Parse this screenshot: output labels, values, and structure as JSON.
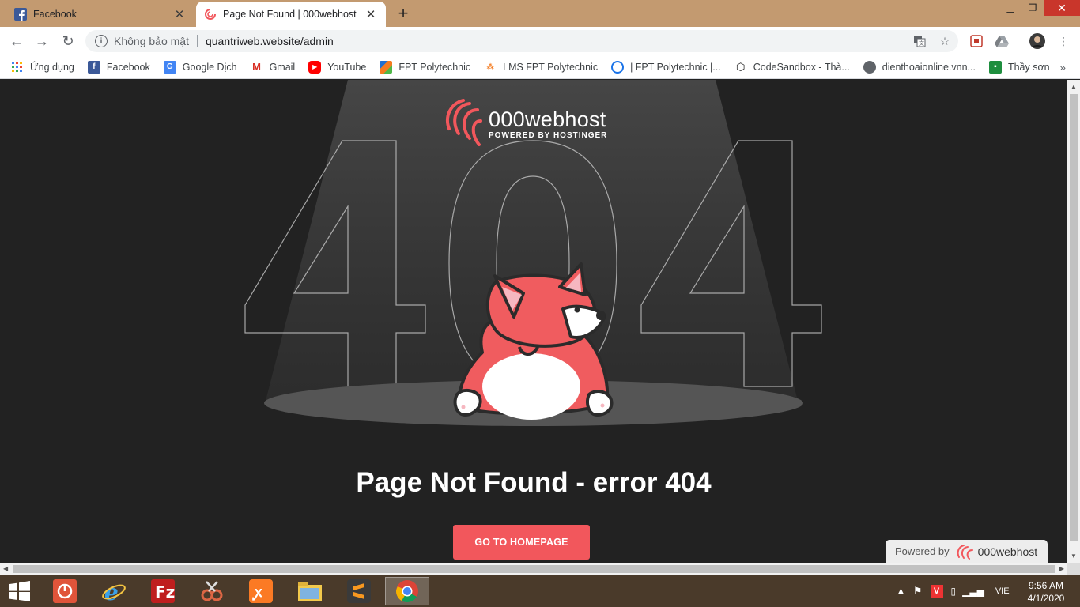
{
  "tabs": [
    {
      "title": "Facebook",
      "favicon": "facebook-icon"
    },
    {
      "title": "Page Not Found | 000webhost",
      "favicon": "000webhost-icon"
    }
  ],
  "address": {
    "security_label": "Không bảo mật",
    "url": "quantriweb.website/admin"
  },
  "bookmarks": [
    {
      "label": "Ứng dụng",
      "icon": "apps-grid-icon"
    },
    {
      "label": "Facebook",
      "icon": "facebook-icon"
    },
    {
      "label": "Google Dịch",
      "icon": "google-translate-icon"
    },
    {
      "label": "Gmail",
      "icon": "gmail-icon"
    },
    {
      "label": "YouTube",
      "icon": "youtube-icon"
    },
    {
      "label": "FPT Polytechnic",
      "icon": "fpt-icon"
    },
    {
      "label": "LMS FPT Polytechnic",
      "icon": "lms-icon"
    },
    {
      "label": "| FPT Polytechnic |...",
      "icon": "circle-icon"
    },
    {
      "label": "CodeSandbox - Thà...",
      "icon": "codesandbox-icon"
    },
    {
      "label": "dienthoaionline.vnn...",
      "icon": "globe-icon"
    },
    {
      "label": "Thầy sơn",
      "icon": "classroom-icon"
    }
  ],
  "page": {
    "logo_name": "000webhost",
    "logo_tagline": "POWERED BY HOSTINGER",
    "big_code": "404",
    "heading": "Page Not Found - error 404",
    "cta_label": "GO TO HOMEPAGE",
    "powered_by_label": "Powered by",
    "powered_by_name": "000webhost"
  },
  "taskbar": {
    "language": "VIE",
    "time": "9:56 AM",
    "date": "4/1/2020"
  },
  "colors": {
    "brand_red": "#f2575c",
    "page_bg": "#222222",
    "titlebar": "#c39a70"
  }
}
